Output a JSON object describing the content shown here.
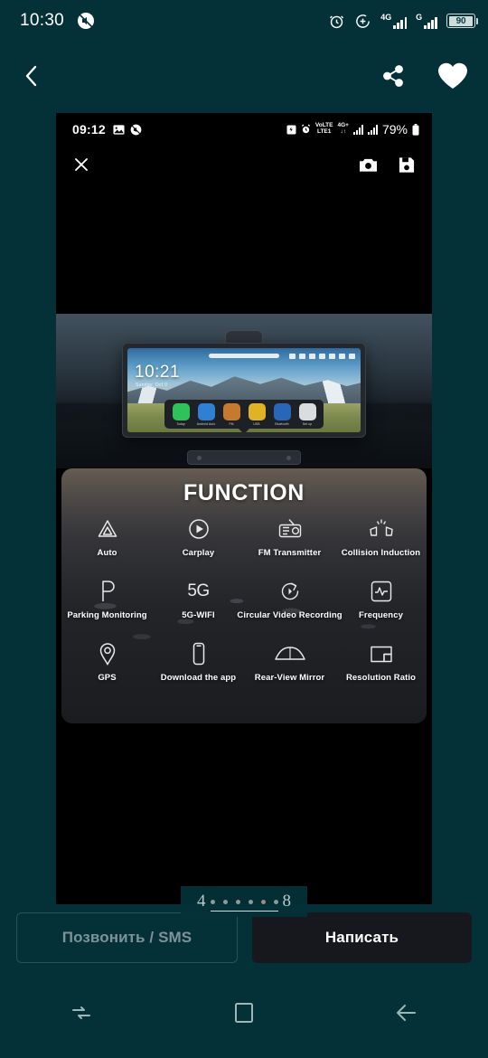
{
  "os_status_bar": {
    "clock": "10:30",
    "icons_left": [
      "mute-notification-icon"
    ],
    "icons_right": [
      "alarm-icon",
      "add-circle-icon",
      "signal-4g-icon",
      "signal-g-icon",
      "battery-icon"
    ],
    "network_primary_label": "4G",
    "network_secondary_label": "G",
    "battery_percent": "90"
  },
  "app_bar": {
    "back_icon": "chevron-left-icon",
    "share_icon": "share-icon",
    "favorite_icon": "heart-filled-icon"
  },
  "listing_photo": {
    "inner_status_bar": {
      "clock": "09:12",
      "left_icons": [
        "photo-icon",
        "mute-icon"
      ],
      "right_icons": [
        "battery-saver-icon",
        "alarm-icon"
      ],
      "volte_label": "VoLTE1",
      "network_label": "4G+",
      "battery_percent": "79%"
    },
    "inner_toolbar": {
      "close_icon": "close-x-icon",
      "camera_icon": "camera-icon",
      "save_icon": "save-floppy-icon"
    },
    "device_screen": {
      "clock": "10:21",
      "subtitle": "Sunday, Oct 9",
      "dock_apps": [
        {
          "label": "Today",
          "color": "#2fc15a"
        },
        {
          "label": "Android Auto",
          "color": "#2f7fd4"
        },
        {
          "label": "FM",
          "color": "#c77a2d"
        },
        {
          "label": "USB",
          "color": "#e0b324"
        },
        {
          "label": "Bluetooth",
          "color": "#2a66b8"
        },
        {
          "label": "Set up",
          "color": "#dadde0"
        }
      ]
    },
    "function_panel": {
      "title": "FUNCTION",
      "rows": [
        [
          {
            "label": "Auto",
            "icon": "android-auto-icon"
          },
          {
            "label": "Carplay",
            "icon": "play-circle-icon"
          },
          {
            "label": "FM Transmitter",
            "icon": "radio-icon"
          },
          {
            "label": "Collision Induction",
            "icon": "collision-icon"
          }
        ],
        [
          {
            "label": "Parking Monitoring",
            "icon": "parking-p-icon"
          },
          {
            "label": "5G-WIFI",
            "icon": "5g-icon",
            "glyph": "5G"
          },
          {
            "label": "Circular Video Recording",
            "icon": "loop-record-icon"
          },
          {
            "label": "Frequency",
            "icon": "waveform-icon"
          }
        ],
        [
          {
            "label": "GPS",
            "icon": "location-pin-icon"
          },
          {
            "label": "Download the app",
            "icon": "phone-icon"
          },
          {
            "label": "Rear-View Mirror",
            "icon": "rear-view-mirror-icon"
          },
          {
            "label": "Resolution Ratio",
            "icon": "resolution-icon"
          }
        ]
      ]
    },
    "pager": {
      "current": "4",
      "total": "8",
      "dot_count": 6,
      "active_dot_index": 4
    }
  },
  "actions": {
    "call_sms_label": "Позвонить / SMS",
    "message_label": "Написать"
  },
  "nav_bar": {
    "recents_icon": "recents-icon",
    "home_icon": "home-square-icon",
    "back_icon": "back-arrow-icon"
  },
  "colors": {
    "page_background": "#033137",
    "photo_background": "#000000",
    "primary_button": "#16181d",
    "outline_button_border": "#2a5156",
    "outline_button_text": "#7e9397"
  }
}
